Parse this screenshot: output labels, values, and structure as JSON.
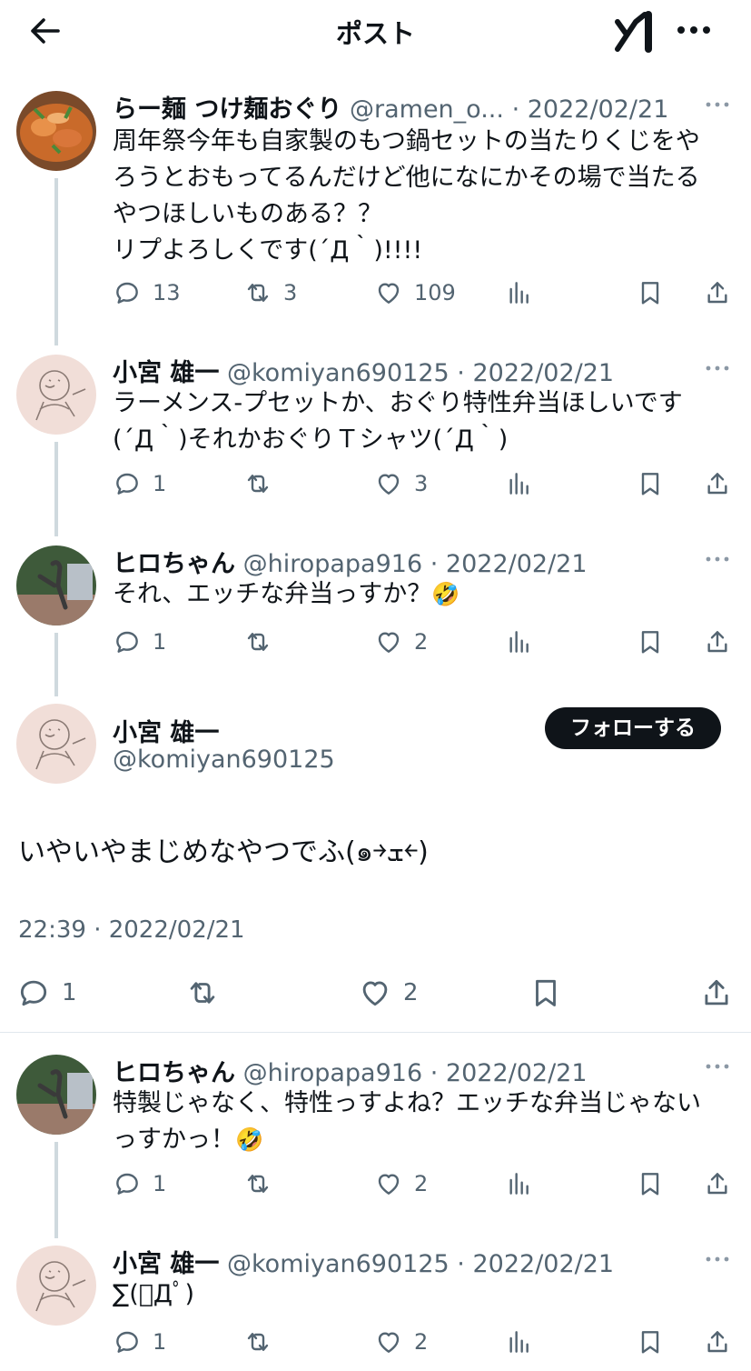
{
  "header": {
    "title": "ポスト"
  },
  "tweets": [
    {
      "name": "らー麺 つけ麺おぐり",
      "handle": "@ramen_o...",
      "date": "2022/02/21",
      "lines": [
        "周年祭今年も自家製のもつ鍋セットの当たりくじをや",
        "ろうとおもってるんだけど他になにかその場で当たる",
        "やつほしいものある？？",
        "リプよろしくです(´Д｀)!!!!"
      ],
      "replies": "13",
      "retweets": "3",
      "likes": "109"
    },
    {
      "name": "小宮 雄一",
      "handle": "@komiyan690125",
      "date": "2022/02/21",
      "lines": [
        "ラーメンス-プセットか、おぐり特性弁当ほしいです",
        "(´Д｀)それかおぐりＴシャツ(´Д｀)"
      ],
      "replies": "1",
      "retweets": "",
      "likes": "3"
    },
    {
      "name": "ヒロちゃん",
      "handle": "@hiropapa916",
      "date": "2022/02/21",
      "lines": [
        "それ、エッチな弁当っすか？"
      ],
      "emoji": "🤣",
      "replies": "1",
      "retweets": "",
      "likes": "2"
    },
    {
      "name": "ヒロちゃん",
      "handle": "@hiropapa916",
      "date": "2022/02/21",
      "lines": [
        "特製じゃなく、特性っすよね？エッチな弁当じゃない",
        "っすかっ！"
      ],
      "emoji": "🤣",
      "replies": "1",
      "retweets": "",
      "likes": "2"
    },
    {
      "name": "小宮 雄一",
      "handle": "@komiyan690125",
      "date": "2022/02/21",
      "lines": [
        "∑(ﾟДﾟ)"
      ],
      "replies": "1",
      "retweets": "",
      "likes": "2"
    }
  ],
  "focus": {
    "name": "小宮 雄一",
    "handle": "@komiyan690125",
    "follow_label": "フォローする",
    "text": "いやいやまじめなやつでふ(๑￫ܫ￩)",
    "timestamp": "22:39 · 2022/02/21",
    "replies": "1",
    "likes": "2"
  },
  "separator": "·",
  "colors": {
    "text": "#0f1419",
    "secondary": "#536471",
    "thread_line": "#cfd9de",
    "button": "#0f1419"
  },
  "icons": [
    "back-arrow-icon",
    "grok-icon",
    "more-icon",
    "reply-icon",
    "retweet-icon",
    "like-icon",
    "views-icon",
    "bookmark-icon",
    "share-icon"
  ]
}
